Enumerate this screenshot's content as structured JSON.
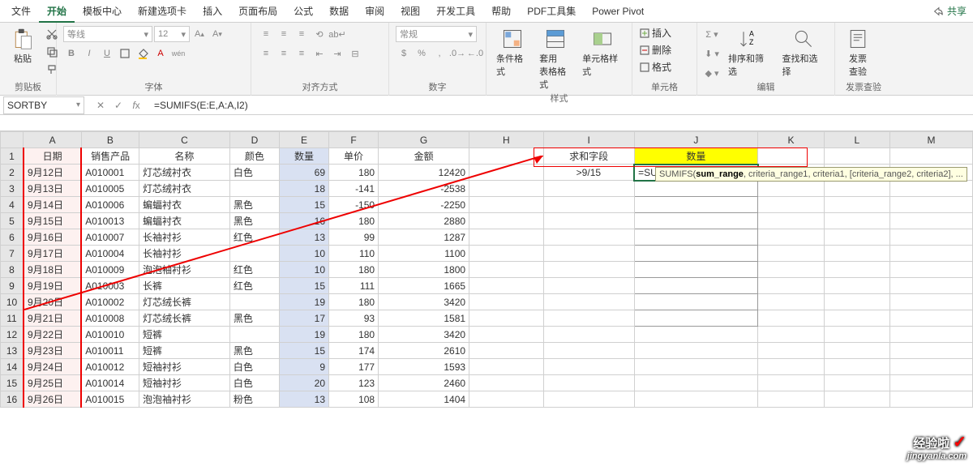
{
  "menu": {
    "tabs": [
      "文件",
      "开始",
      "模板中心",
      "新建选项卡",
      "插入",
      "页面布局",
      "公式",
      "数据",
      "审阅",
      "视图",
      "开发工具",
      "帮助",
      "PDF工具集",
      "Power Pivot"
    ],
    "active": 1,
    "share": "共享"
  },
  "ribbon": {
    "clipboard": {
      "paste": "粘贴",
      "label": "剪贴板"
    },
    "font": {
      "label": "字体",
      "name": "等线",
      "size": "12",
      "buttons": [
        "B",
        "I",
        "U"
      ]
    },
    "align": {
      "label": "对齐方式"
    },
    "number": {
      "label": "数字",
      "format": "常规"
    },
    "styles": {
      "label": "样式",
      "cond": "条件格式",
      "table": "套用\n表格格式",
      "cell": "单元格样式"
    },
    "cells": {
      "label": "单元格",
      "insert": "插入",
      "delete": "删除",
      "format": "格式"
    },
    "editing": {
      "label": "编辑",
      "sort": "排序和筛选",
      "find": "查找和选择"
    },
    "invoice": {
      "label": "发票查验",
      "btn": "发票\n查验"
    }
  },
  "namebox": "SORTBY",
  "formula": "=SUMIFS(E:E,A:A,I2)",
  "cell_formula": "=SUMIFS(E:E,A:A,I2)",
  "tooltip": {
    "fn": "SUMIFS(",
    "p1": "sum_range",
    "p2": ", criteria_range1",
    "p3": ", criteria1, [criteria_range2, criteria2], ..."
  },
  "cols": [
    "",
    "A",
    "B",
    "C",
    "D",
    "E",
    "F",
    "G",
    "H",
    "I",
    "J",
    "K",
    "L",
    "M"
  ],
  "headers": {
    "date": "日期",
    "prod": "销售产品",
    "name": "名称",
    "color": "颜色",
    "qty": "数量",
    "price": "单价",
    "amount": "金额",
    "sumfield": "求和字段",
    "qty2": "数量"
  },
  "i2": ">9/15",
  "rows": [
    {
      "n": 2,
      "date": "9月12日",
      "prod": "A010001",
      "name": "灯芯绒衬衣",
      "color": "白色",
      "qty": 69,
      "price": 180,
      "amount": 12420
    },
    {
      "n": 3,
      "date": "9月13日",
      "prod": "A010005",
      "name": "灯芯绒衬衣",
      "color": "",
      "qty": 18,
      "price": -141,
      "amount": -2538
    },
    {
      "n": 4,
      "date": "9月14日",
      "prod": "A010006",
      "name": "蝙蝠衬衣",
      "color": "黑色",
      "qty": 15,
      "price": -150,
      "amount": -2250
    },
    {
      "n": 5,
      "date": "9月15日",
      "prod": "A010013",
      "name": "蝙蝠衬衣",
      "color": "黑色",
      "qty": 16,
      "price": 180,
      "amount": 2880
    },
    {
      "n": 6,
      "date": "9月16日",
      "prod": "A010007",
      "name": "长袖衬衫",
      "color": "红色",
      "qty": 13,
      "price": 99,
      "amount": 1287
    },
    {
      "n": 7,
      "date": "9月17日",
      "prod": "A010004",
      "name": "长袖衬衫",
      "color": "",
      "qty": 10,
      "price": 110,
      "amount": 1100
    },
    {
      "n": 8,
      "date": "9月18日",
      "prod": "A010009",
      "name": "泡泡袖衬衫",
      "color": "红色",
      "qty": 10,
      "price": 180,
      "amount": 1800
    },
    {
      "n": 9,
      "date": "9月19日",
      "prod": "A010003",
      "name": "长裤",
      "color": "红色",
      "qty": 15,
      "price": 111,
      "amount": 1665
    },
    {
      "n": 10,
      "date": "9月20日",
      "prod": "A010002",
      "name": "灯芯绒长裤",
      "color": "",
      "qty": 19,
      "price": 180,
      "amount": 3420
    },
    {
      "n": 11,
      "date": "9月21日",
      "prod": "A010008",
      "name": "灯芯绒长裤",
      "color": "黑色",
      "qty": 17,
      "price": 93,
      "amount": 1581
    },
    {
      "n": 12,
      "date": "9月22日",
      "prod": "A010010",
      "name": "短裤",
      "color": "",
      "qty": 19,
      "price": 180,
      "amount": 3420
    },
    {
      "n": 13,
      "date": "9月23日",
      "prod": "A010011",
      "name": "短裤",
      "color": "黑色",
      "qty": 15,
      "price": 174,
      "amount": 2610
    },
    {
      "n": 14,
      "date": "9月24日",
      "prod": "A010012",
      "name": "短袖衬衫",
      "color": "白色",
      "qty": 9,
      "price": 177,
      "amount": 1593
    },
    {
      "n": 15,
      "date": "9月25日",
      "prod": "A010014",
      "name": "短袖衬衫",
      "color": "白色",
      "qty": 20,
      "price": 123,
      "amount": 2460
    },
    {
      "n": 16,
      "date": "9月26日",
      "prod": "A010015",
      "name": "泡泡袖衬衫",
      "color": "粉色",
      "qty": 13,
      "price": 108,
      "amount": 1404
    }
  ],
  "watermark": {
    "text": "经验啦",
    "url": "jingyanla.com"
  }
}
